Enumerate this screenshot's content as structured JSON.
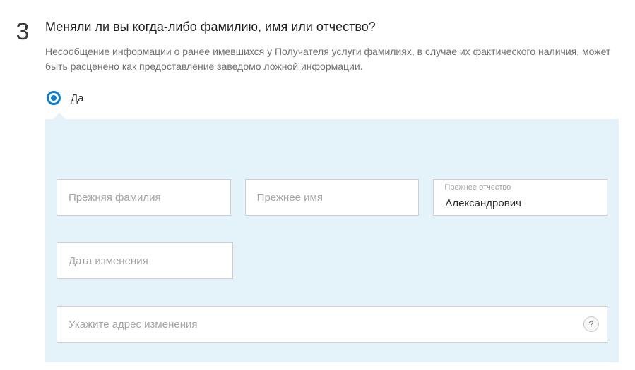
{
  "step": {
    "number": "3",
    "title": "Меняли ли вы когда-либо фамилию, имя или отчество?",
    "hint": "Несообщение информации о ранее имевшихся у Получателя услуги фамилиях, в случае их фактического наличия, может быть расценено как предоставление заведомо ложной информации."
  },
  "radio": {
    "yes_label": "Да"
  },
  "fields": {
    "prev_surname": {
      "placeholder": "Прежняя фамилия",
      "value": ""
    },
    "prev_name": {
      "placeholder": "Прежнее имя",
      "value": ""
    },
    "prev_patronymic": {
      "float_label": "Прежнее отчество",
      "value": "Александрович"
    },
    "change_date": {
      "placeholder": "Дата изменения",
      "value": ""
    },
    "change_address": {
      "placeholder": "Укажите адрес изменения",
      "value": ""
    }
  },
  "help": {
    "symbol": "?"
  }
}
